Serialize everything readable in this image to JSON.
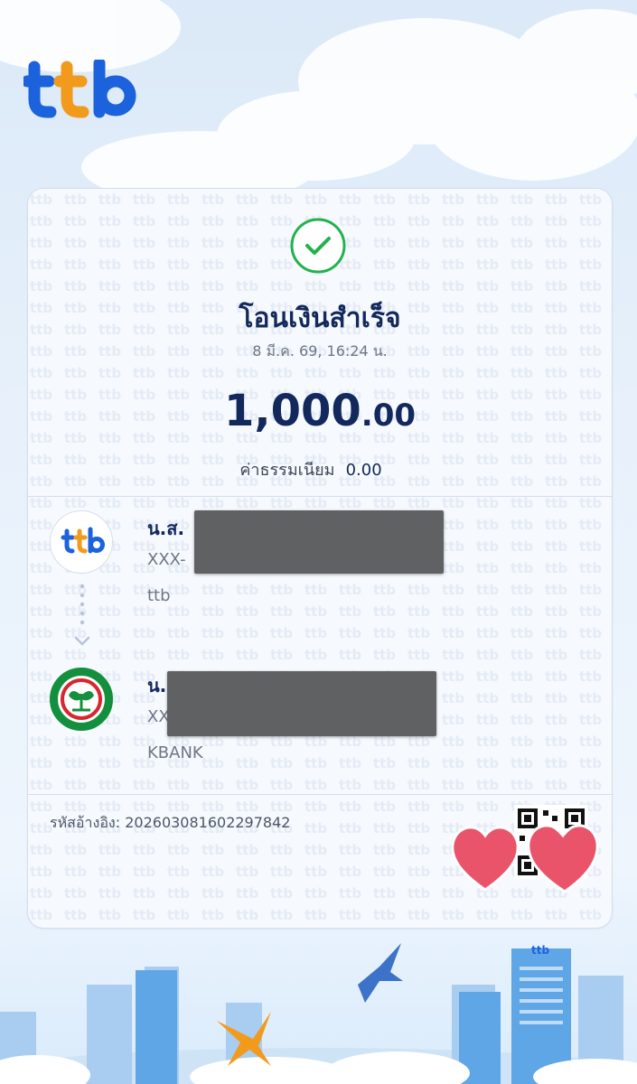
{
  "brand": {
    "name": "ttb",
    "colors": {
      "blue": "#1c62dd",
      "orange": "#f29a1c",
      "navy": "#13285c",
      "success": "#22b24c"
    }
  },
  "receipt": {
    "status_title": "โอนเงินสำเร็จ",
    "datetime": "8 มี.ค. 69, 16:24 น.",
    "amount_int": "1,000",
    "amount_dec": ".00",
    "fee_label": "ค่าธรรมเนียม",
    "fee_value": "0.00",
    "sender": {
      "name_prefix": "น.ส. ",
      "account": "XXX-",
      "bank": "ttb",
      "icon": "ttb-logo-icon"
    },
    "receiver": {
      "name_prefix": "น.ส. ",
      "account": "XXX",
      "bank": "KBANK",
      "icon": "kbank-logo-icon"
    },
    "reference_label": "รหัสอ้างอิง:",
    "reference_value": "202603081602297842"
  },
  "icons": [
    "check-circle-icon",
    "chevron-down-icon",
    "qr-code-icon",
    "heart-sticker-icon"
  ]
}
